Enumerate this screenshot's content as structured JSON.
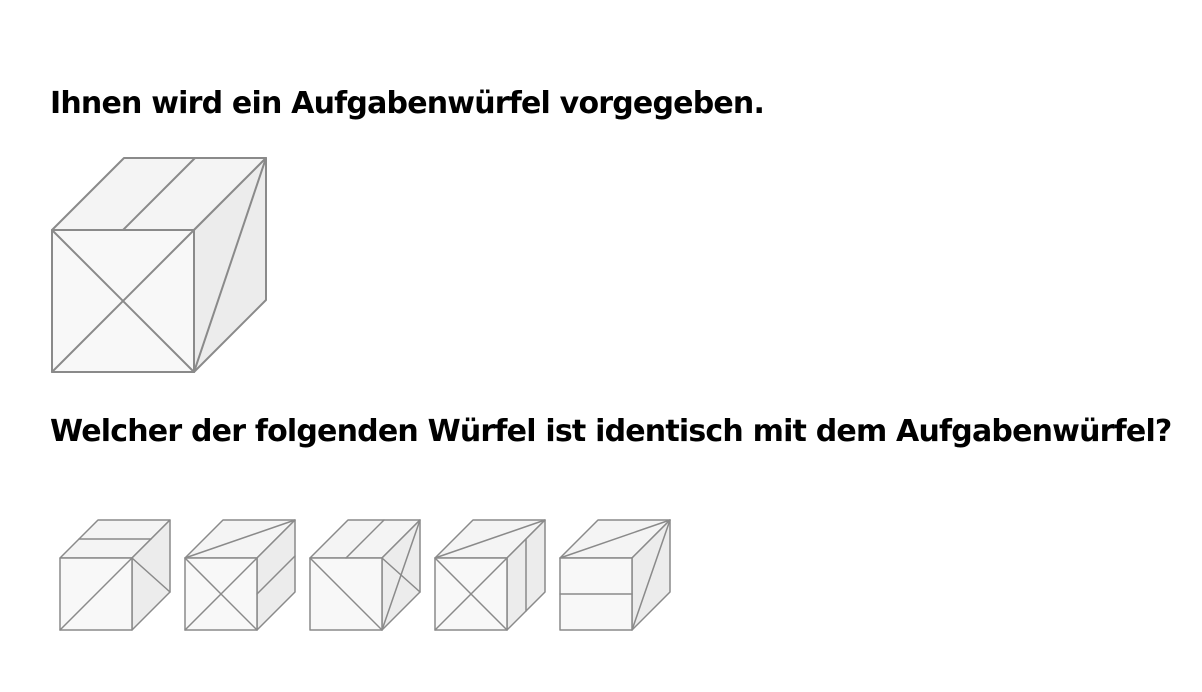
{
  "task": {
    "intro_text": "Ihnen wird ein Aufgabenwürfel vorgegeben.",
    "question_text": "Welcher der folgenden Würfel ist identisch mit dem Aufgabenwürfel?"
  },
  "colors": {
    "edge": "#8a8a8a",
    "face_top": "#f4f4f4",
    "face_front": "#f8f8f8",
    "face_side": "#ececec",
    "text": "#000000"
  },
  "cubes": {
    "reference": {
      "top_marks": [
        "vertical-line"
      ],
      "front_marks": [
        "x-cross"
      ],
      "side_marks": [
        "diagonal-up"
      ]
    },
    "options": [
      {
        "top_marks": [
          "horizontal-line"
        ],
        "front_marks": [
          "diagonal-up"
        ],
        "side_marks": [
          "diagonal-down"
        ]
      },
      {
        "top_marks": [
          "diagonal-up"
        ],
        "front_marks": [
          "x-cross"
        ],
        "side_marks": [
          "horizontal-line"
        ]
      },
      {
        "top_marks": [
          "vertical-line"
        ],
        "front_marks": [
          "diagonal-down"
        ],
        "side_marks": [
          "x-cross"
        ]
      },
      {
        "top_marks": [
          "diagonal-up"
        ],
        "front_marks": [
          "x-cross"
        ],
        "side_marks": [
          "vertical-line"
        ]
      },
      {
        "top_marks": [
          "diagonal-up"
        ],
        "front_marks": [
          "horizontal-line"
        ],
        "side_marks": [
          "diagonal-up"
        ]
      }
    ]
  }
}
